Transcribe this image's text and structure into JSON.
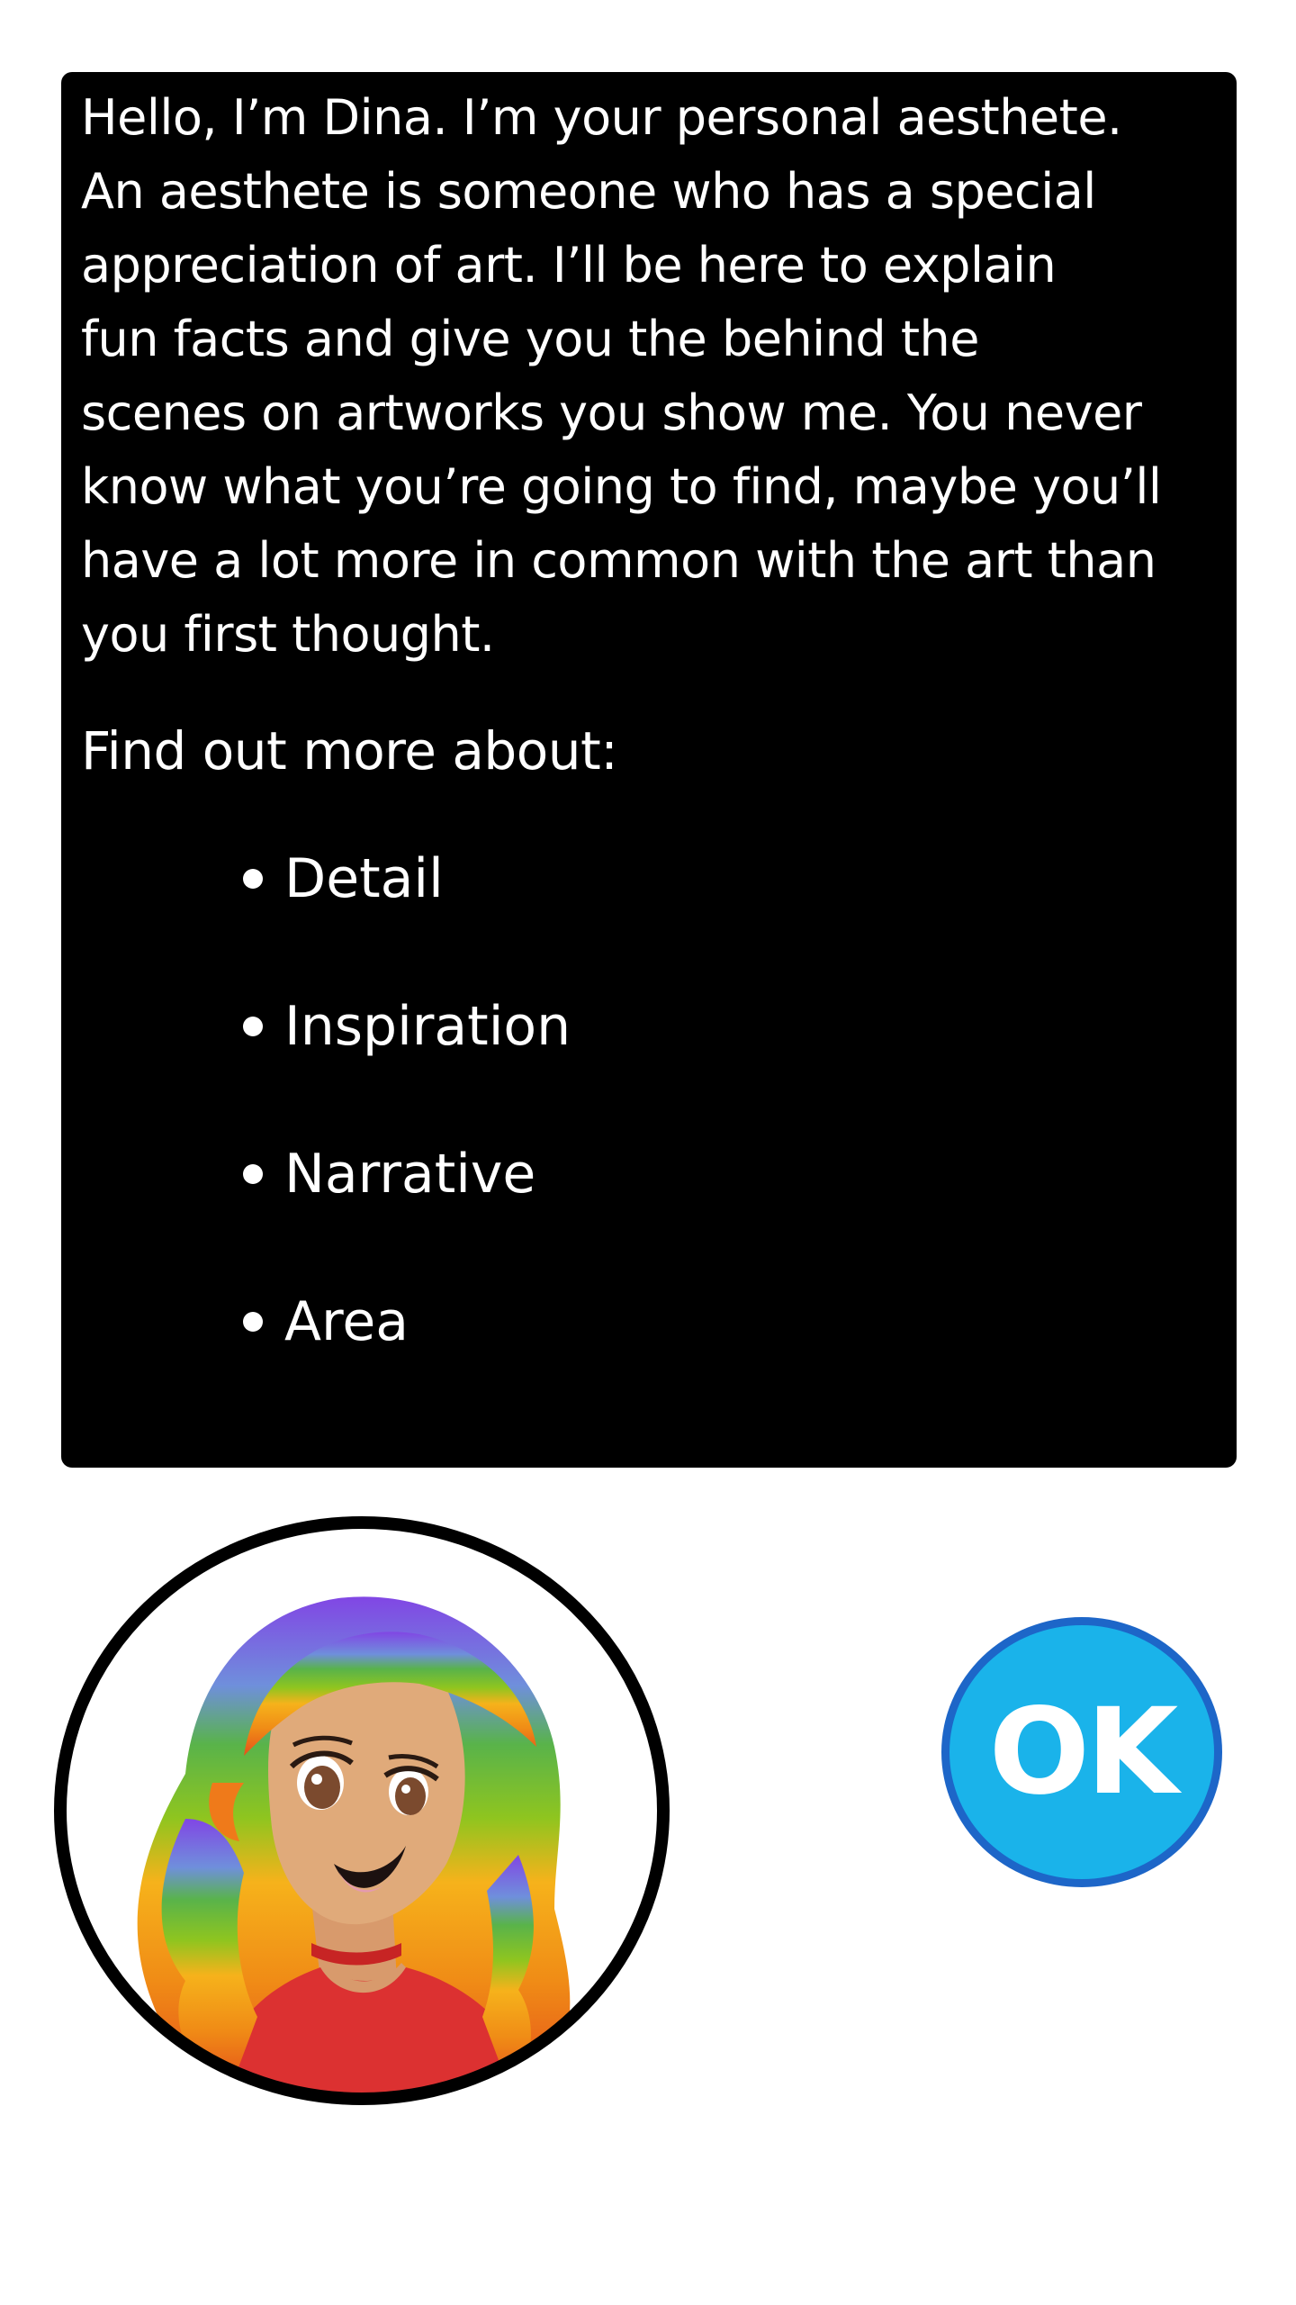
{
  "dialog": {
    "intro": "Hello, I’m Dina. I’m your personal aesthete.\nAn aesthete is someone who has a special\nappreciation of art. I’ll be here to explain\n fun facts and give you the behind the\nscenes on artworks you show me. You never\nknow what you’re going to find, maybe you’ll\nhave a lot more in common with the art than\nyou first thought.",
    "find_out_label": "Find out more about:",
    "topics": [
      "Detail",
      "Inspiration",
      "Narrative",
      "Area"
    ]
  },
  "avatar": {
    "icon": "dina-avatar-icon"
  },
  "ok_button": {
    "label": "OK"
  },
  "colors": {
    "panel_background": "#000000",
    "panel_text": "#ffffff",
    "ok_fill": "#1ab3ea",
    "ok_border": "#1d66c8",
    "avatar_ring": "#000000"
  }
}
